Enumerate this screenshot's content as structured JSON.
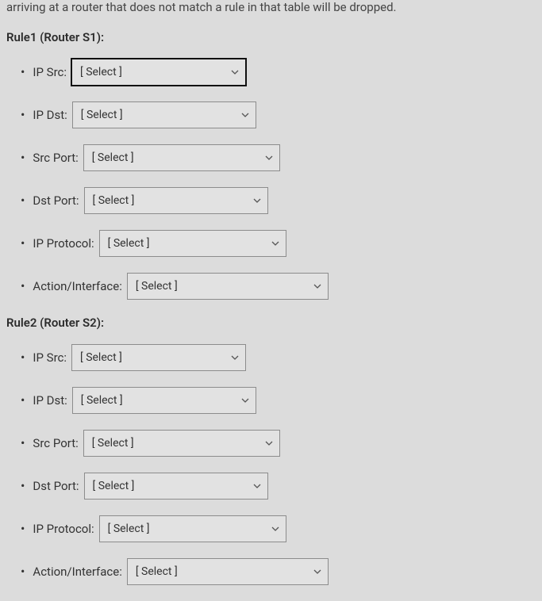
{
  "top_text": "arriving at a router that does not match a rule in that table will be dropped.",
  "select_placeholder": "[ Select ]",
  "rule1": {
    "heading": "Rule1 (Router S1):",
    "fields": {
      "ip_src": {
        "label": "IP Src:"
      },
      "ip_dst": {
        "label": "IP Dst:"
      },
      "src_port": {
        "label": "Src Port:"
      },
      "dst_port": {
        "label": "Dst Port:"
      },
      "ip_protocol": {
        "label": "IP Protocol:"
      },
      "action_interface": {
        "label": "Action/Interface:"
      }
    }
  },
  "rule2": {
    "heading": "Rule2 (Router S2):",
    "fields": {
      "ip_src": {
        "label": "IP Src:"
      },
      "ip_dst": {
        "label": "IP Dst:"
      },
      "src_port": {
        "label": "Src Port:"
      },
      "dst_port": {
        "label": "Dst Port:"
      },
      "ip_protocol": {
        "label": "IP Protocol:"
      },
      "action_interface": {
        "label": "Action/Interface:"
      }
    }
  }
}
